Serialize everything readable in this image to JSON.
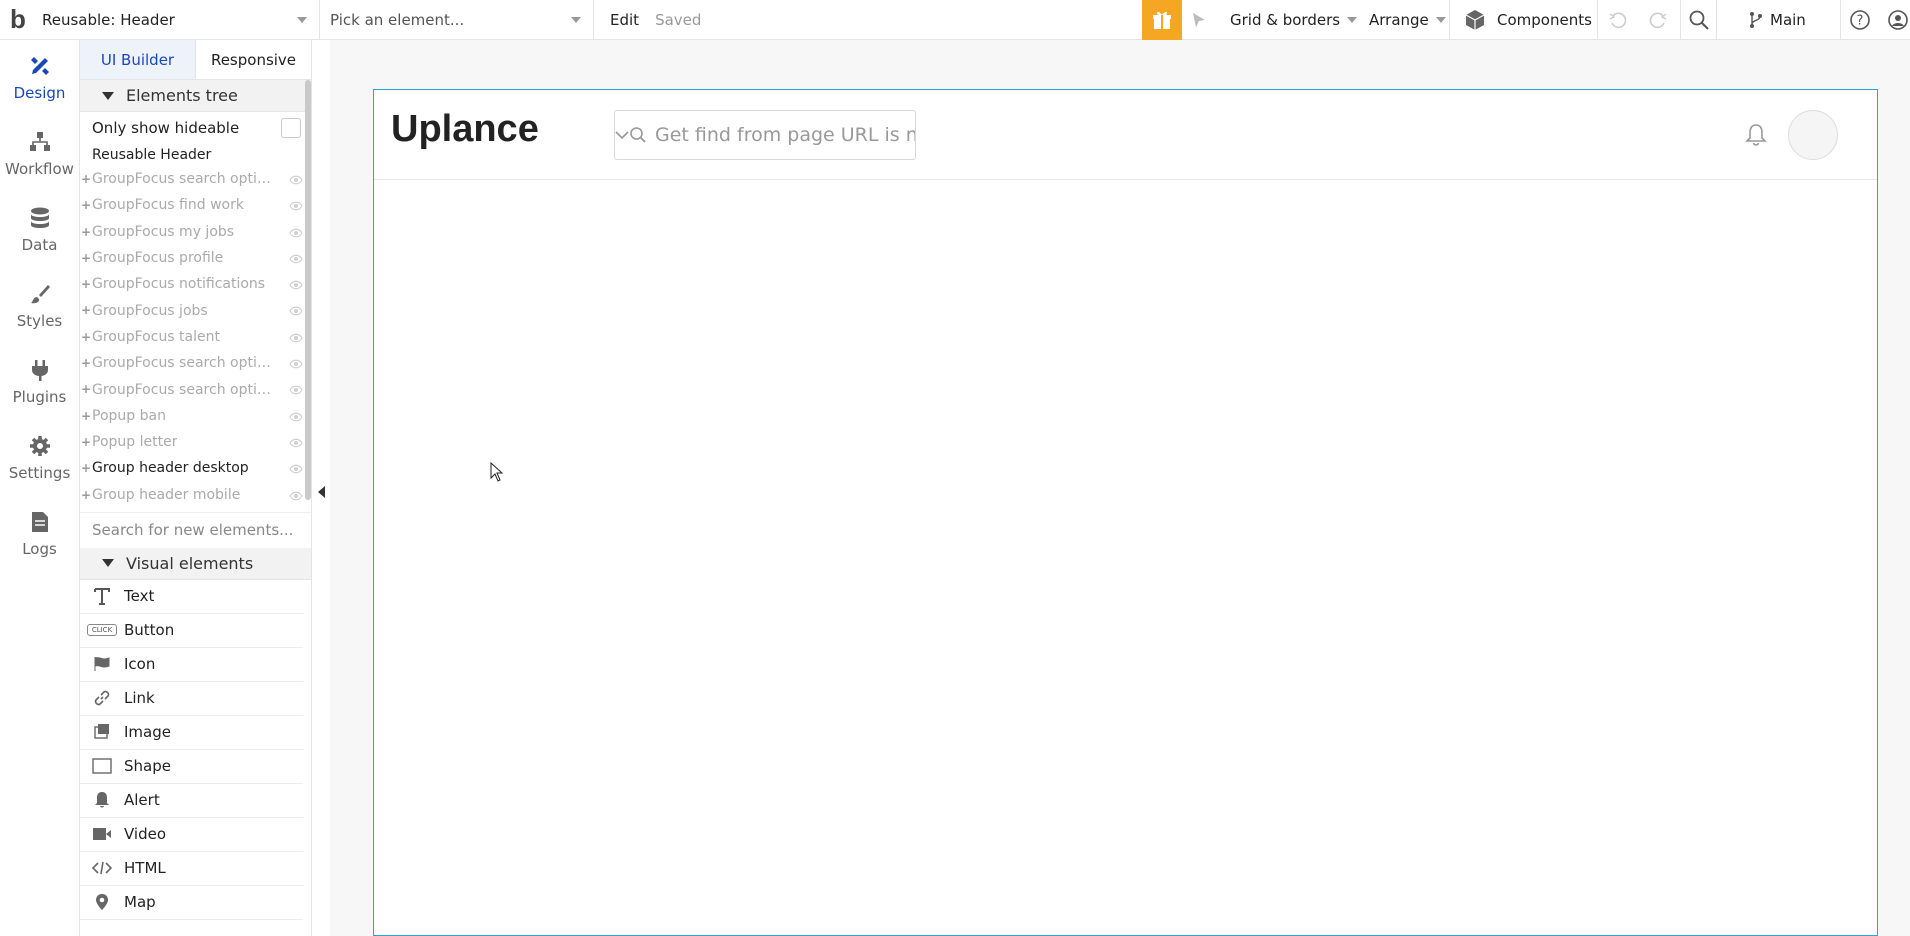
{
  "topbar": {
    "page_selector": "Reusable: Header",
    "element_picker": "Pick an element...",
    "edit_label": "Edit",
    "status": "Saved",
    "grid_label": "Grid & borders",
    "arrange_label": "Arrange",
    "components_label": "Components",
    "branch_label": "Main",
    "accent_color": "#f5a623"
  },
  "rail": {
    "items": [
      {
        "label": "Design",
        "icon": "design-icon"
      },
      {
        "label": "Workflow",
        "icon": "workflow-icon"
      },
      {
        "label": "Data",
        "icon": "data-icon"
      },
      {
        "label": "Styles",
        "icon": "styles-icon"
      },
      {
        "label": "Plugins",
        "icon": "plugins-icon"
      },
      {
        "label": "Settings",
        "icon": "settings-icon"
      },
      {
        "label": "Logs",
        "icon": "logs-icon"
      }
    ]
  },
  "panel": {
    "tabs": [
      "UI Builder",
      "Responsive"
    ],
    "elements_tree_title": "Elements tree",
    "only_hideable_label": "Only show hideable",
    "tree_root": "Reusable Header",
    "tree_items": [
      "GroupFocus search option...",
      "GroupFocus find work",
      "GroupFocus my jobs",
      "GroupFocus profile",
      "GroupFocus notifications",
      "GroupFocus jobs",
      "GroupFocus talent",
      "GroupFocus search option...",
      "GroupFocus search option...",
      "Popup ban",
      "Popup letter",
      "Group header desktop",
      "Group header mobile"
    ],
    "search_placeholder": "Search for new elements...",
    "visual_elements_title": "Visual elements",
    "visual_elements": [
      "Text",
      "Button",
      "Icon",
      "Link",
      "Image",
      "Shape",
      "Alert",
      "Video",
      "HTML",
      "Map"
    ],
    "button_icon_text": "CLICK"
  },
  "canvas": {
    "brand": "Uplance",
    "search_placeholder": "Get find from page URL is no",
    "selection_color": "#29a4d6"
  }
}
